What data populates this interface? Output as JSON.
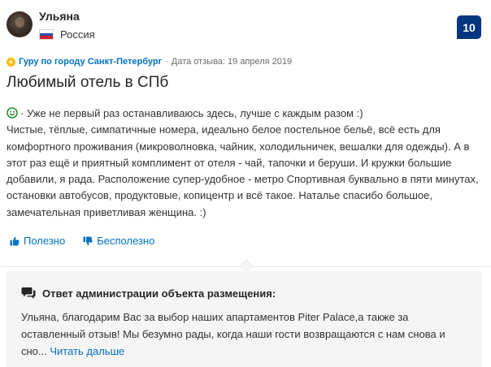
{
  "reviewer": {
    "name": "Ульяна",
    "country": "Россия"
  },
  "score": "10",
  "meta": {
    "guru_label": "Гуру по городу Санкт-Петербург",
    "separator": " · ",
    "date_text": "Дата отзыва: 19 апреля 2019"
  },
  "review": {
    "title": "Любимый отель в СПб",
    "positive_prefix": "· Уже не первый раз останавливаюсь здесь, лучше с каждым разом :)",
    "body": "Чистые, тёплые, симпатичные номера, идеально белое постельное бельё, всё есть для комфортного проживания (микроволновка, чайник, холодильничек, вешалки для одежды). А в этот раз ещё и приятный комплимент от отеля - чай, тапочки и беруши. И кружки большие добавили, я рада. Расположение супер-удобное - метро Спортивная буквально в пяти минутах, остановки автобусов, продуктовые, копицентр и всё такое. Наталье спасибо большое, замечательная приветливая женщина. :)"
  },
  "votes": {
    "helpful_label": "Полезно",
    "unhelpful_label": "Бесполезно"
  },
  "response": {
    "heading": "Ответ администрации объекта размещения:",
    "text": "Ульяна, благодарим Вас за выбор наших апартаментов Piter Palace,а также за оставленный отзыв! Мы безумно рады, когда наши гости возвращаются с нам снова и сно...",
    "read_more": "Читать дальше"
  },
  "colors": {
    "score_bg": "#003580",
    "link": "#0071c2",
    "guru_badge": "#febb02",
    "positive_icon": "#008009"
  },
  "icons": [
    "smile-icon",
    "thumbs-up-icon",
    "thumbs-down-icon",
    "speech-bubble-icon",
    "guru-badge-icon",
    "russia-flag-icon"
  ]
}
